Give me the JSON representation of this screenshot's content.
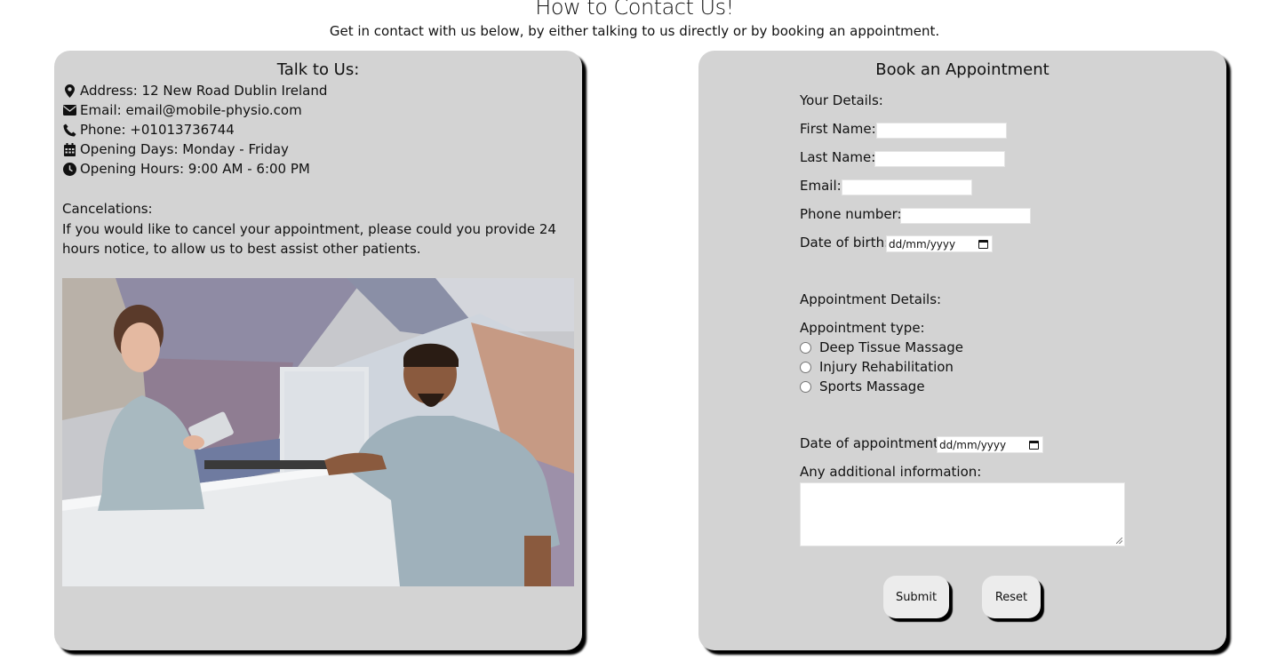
{
  "page": {
    "heading": "How to Contact Us!",
    "subheading": "Get in contact with us below, by either talking to us directly or by booking an appointment."
  },
  "contact": {
    "title": "Talk to Us:",
    "address": "Address: 12 New Road Dublin Ireland",
    "email": "Email: email@mobile-physio.com",
    "phone": "Phone: +01013736744",
    "opening_days": "Opening Days: Monday - Friday",
    "opening_hours": "Opening Hours: 9:00 AM - 6:00 PM",
    "cancel_title": "Cancelations:",
    "cancel_text": "If you would like to cancel your appointment, please could you provide 24 hours notice, to allow us to best assist other patients.",
    "icons": [
      "map-marker-icon",
      "envelope-icon",
      "phone-icon",
      "calendar-icon",
      "clock-icon"
    ]
  },
  "booking": {
    "title": "Book an Appointment",
    "your_details": "Your Details:",
    "first_name": "First Name:",
    "last_name": "Last Name:",
    "email": "Email:",
    "phone": "Phone number:",
    "dob": "Date of birth:",
    "date_placeholder": "dd/mm/yyyy",
    "appointment_details": "Appointment Details:",
    "appointment_type": "Appointment type:",
    "types": [
      "Deep Tissue Massage",
      "Injury Rehabilitation",
      "Sports Massage"
    ],
    "date_of_appointment": "Date of appointment:",
    "additional_info": "Any additional information:",
    "submit": "Submit",
    "reset": "Reset"
  },
  "colors": {
    "card_bg": "#d3d3d3",
    "button_bg": "#ececec",
    "shadow": "#000000"
  }
}
